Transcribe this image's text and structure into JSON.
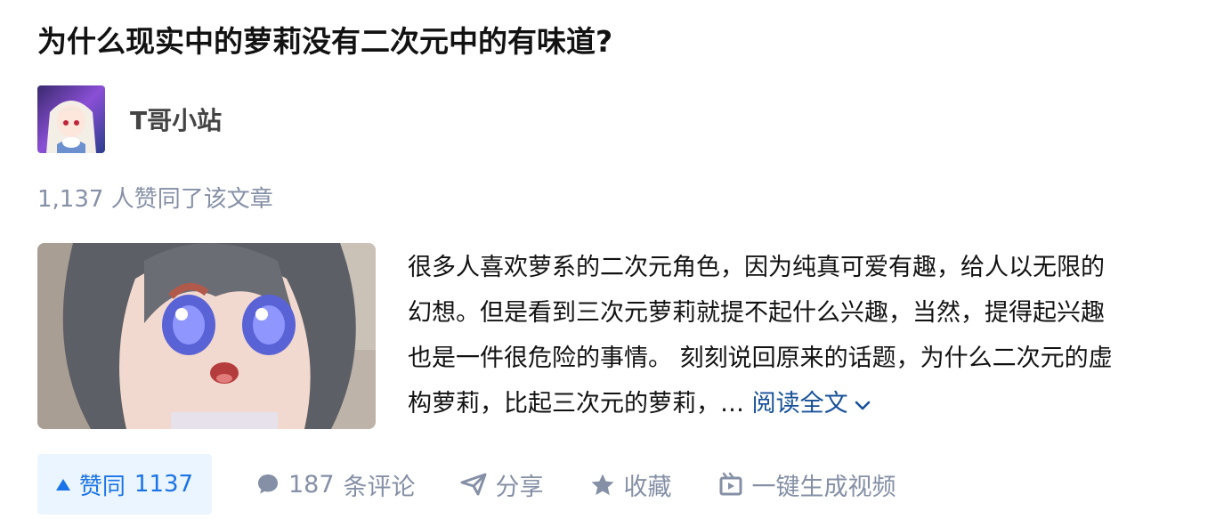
{
  "article": {
    "title": "为什么现实中的萝莉没有二次元中的有味道?",
    "author_name": "T哥小站",
    "vote_summary": "1,137 人赞同了该文章",
    "excerpt_lines": [
      "很多人喜欢萝系的二次元角色，因为纯真可爱有趣，给人以无限的",
      "幻想。但是看到三次元萝莉就提不起什么兴趣，当然，提得起兴趣",
      "也是一件很危险的事情。 刻刻说回原来的话题，为什么二次元的虚",
      "构萝莉，比起三次元的萝莉，… "
    ],
    "read_more": "阅读全文"
  },
  "actions": {
    "vote_label": "赞同",
    "vote_count": "1137",
    "comment_count": "187",
    "comment_label": "条评论",
    "share_label": "分享",
    "favorite_label": "收藏",
    "video_label": "一键生成视频"
  },
  "icons": {
    "vote": "triangle-up-icon",
    "comment": "comment-bubble-icon",
    "share": "paper-plane-icon",
    "favorite": "star-icon",
    "video": "video-generate-icon",
    "read_more": "chevron-down-icon"
  },
  "colors": {
    "accent": "#1a73e8",
    "vote_bg": "#ebf5ff",
    "link": "#175199",
    "muted": "#8590a6",
    "text": "#121212"
  }
}
